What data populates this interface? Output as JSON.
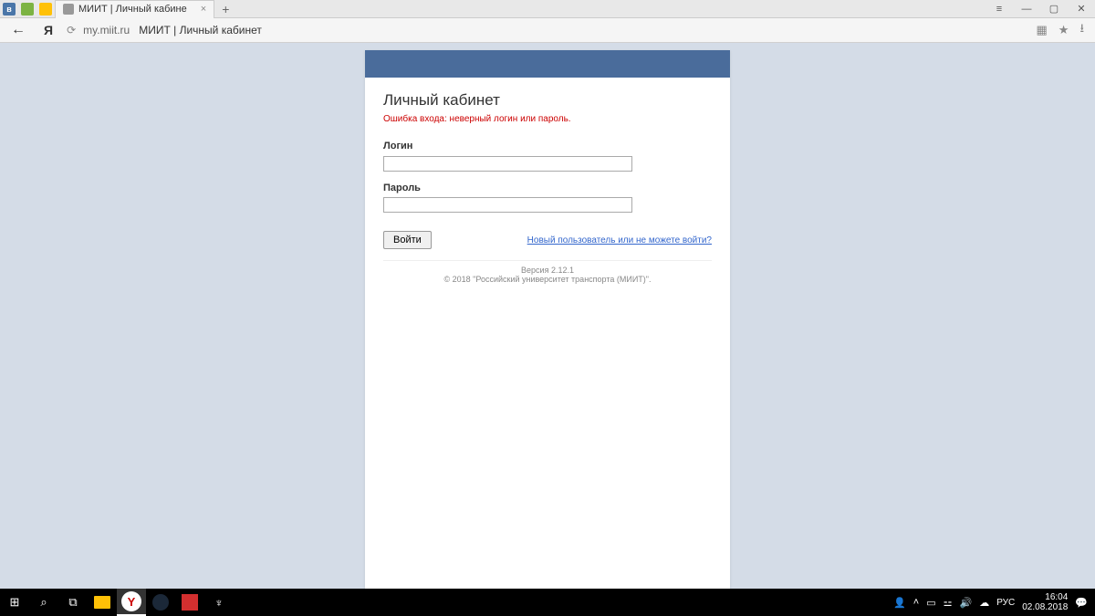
{
  "browser": {
    "tab_title": "МИИТ | Личный кабине",
    "url_domain": "my.miit.ru",
    "url_title": "МИИТ | Личный кабинет",
    "yandex_logo": "Я"
  },
  "login": {
    "title": "Личный кабинет",
    "error": "Ошибка входа: неверный логин или пароль.",
    "login_label": "Логин",
    "password_label": "Пароль",
    "submit_label": "Войти",
    "help_link": "Новый пользователь или не можете войти?",
    "version": "Версия 2.12.1",
    "copyright": "© 2018 \"Российский университет транспорта (МИИТ)\"."
  },
  "taskbar": {
    "lang": "РУС",
    "time": "16:04",
    "date": "02.08.2018"
  }
}
